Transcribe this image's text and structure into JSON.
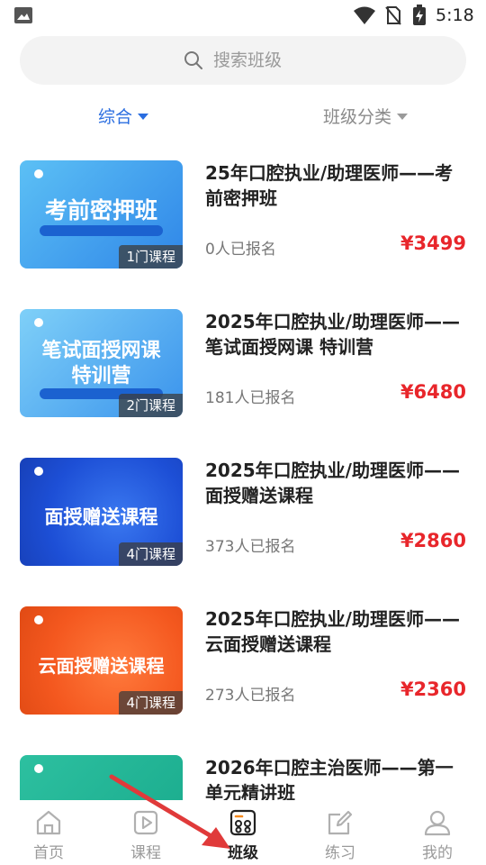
{
  "status_bar": {
    "time": "5:18"
  },
  "search": {
    "placeholder": "搜索班级"
  },
  "filters": {
    "sort_label": "综合",
    "category_label": "班级分类"
  },
  "classes": [
    {
      "title": "25年口腔执业/助理医师——考前密押班",
      "enrolled": "0人已报名",
      "price": "¥3499",
      "course_count": "1门课程",
      "thumb_text": "考前密押班",
      "thumb_color": "#2f86e8"
    },
    {
      "title": "2025年口腔执业/助理医师——笔试面授网课 特训营",
      "enrolled": "181人已报名",
      "price": "¥6480",
      "course_count": "2门课程",
      "thumb_text": "笔试面授网课",
      "thumb_text_2": "特训营",
      "thumb_color": "#3a93ec"
    },
    {
      "title": "2025年口腔执业/助理医师——面授赠送课程",
      "enrolled": "373人已报名",
      "price": "¥2860",
      "course_count": "4门课程",
      "thumb_text": "面授赠送课程",
      "thumb_color": "#1d4fd6"
    },
    {
      "title": "2025年口腔执业/助理医师——云面授赠送课程",
      "enrolled": "273人已报名",
      "price": "¥2360",
      "course_count": "4门课程",
      "thumb_text": "云面授赠送课程",
      "thumb_color": "#f4581f"
    },
    {
      "title": "2026年口腔主治医师——第一单元精讲班",
      "thumb_color": "#18a98b"
    }
  ],
  "bottom_nav": [
    {
      "label": "首页",
      "icon": "home-icon"
    },
    {
      "label": "课程",
      "icon": "play-icon"
    },
    {
      "label": "班级",
      "icon": "class-icon"
    },
    {
      "label": "练习",
      "icon": "edit-icon"
    },
    {
      "label": "我的",
      "icon": "person-icon"
    }
  ],
  "colors": {
    "accent": "#2a6de0",
    "price": "#e8262b",
    "annotation": "#e03a3a"
  }
}
